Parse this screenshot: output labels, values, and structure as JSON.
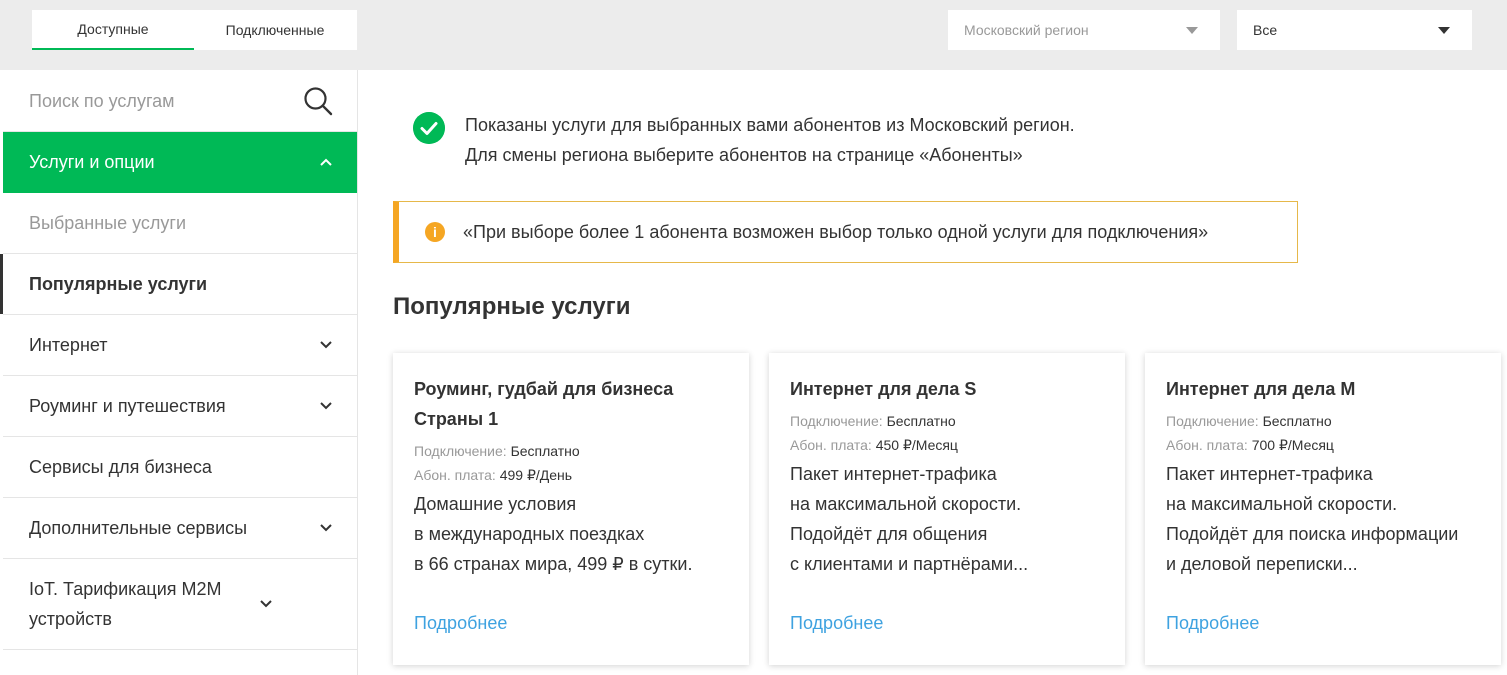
{
  "header": {
    "tabs": [
      {
        "label": "Доступные"
      },
      {
        "label": "Подключенные"
      }
    ],
    "region_select": {
      "value": "Московский регион"
    },
    "filter_select": {
      "value": "Все"
    }
  },
  "sidebar": {
    "search_placeholder": "Поиск по услугам",
    "items": [
      {
        "label": "Услуги и опции"
      },
      {
        "label": "Выбранные услуги"
      },
      {
        "label": "Популярные услуги"
      },
      {
        "label": "Интернет"
      },
      {
        "label": "Роуминг и путешествия"
      },
      {
        "label": "Сервисы для бизнеса"
      },
      {
        "label": "Дополнительные сервисы"
      },
      {
        "label": "IoT. Тарификация M2M устройств"
      }
    ]
  },
  "main": {
    "notice_line1": "Показаны услуги для выбранных вами абонентов из Московский регион.",
    "notice_line2": "Для смены региона выберите абонентов на странице «Абоненты»",
    "warning": "«При выборе более 1 абонента возможен выбор только одной услуги для подключения»",
    "section_title": "Популярные услуги",
    "cards": [
      {
        "title_line1": "Роуминг, гудбай для бизнеса",
        "title_line2": "Страны 1",
        "connection_label": "Подключение:",
        "connection_value": "Бесплатно",
        "fee_label": "Абон. плата:",
        "fee_value": "499 ₽/День",
        "desc_line1": "Домашние условия",
        "desc_line2": "в международных поездках",
        "desc_line3": "в 66 странах мира, 499 ₽ в сутки.",
        "desc_line4": "",
        "more": "Подробнее"
      },
      {
        "title_line1": "Интернет для дела S",
        "title_line2": "",
        "connection_label": "Подключение:",
        "connection_value": "Бесплатно",
        "fee_label": "Абон. плата:",
        "fee_value": "450 ₽/Месяц",
        "desc_line1": "Пакет интернет-трафика",
        "desc_line2": "на максимальной скорости.",
        "desc_line3": "Подойдёт для общения",
        "desc_line4": "с клиентами и партнёрами...",
        "more": "Подробнее"
      },
      {
        "title_line1": "Интернет для дела M",
        "title_line2": "",
        "connection_label": "Подключение:",
        "connection_value": "Бесплатно",
        "fee_label": "Абон. плата:",
        "fee_value": "700 ₽/Месяц",
        "desc_line1": "Пакет интернет-трафика",
        "desc_line2": "на максимальной скорости.",
        "desc_line3": "Подойдёт для поиска информации",
        "desc_line4": "и деловой переписки...",
        "more": "Подробнее"
      }
    ]
  },
  "colors": {
    "accent": "#00b956",
    "warning": "#f5a623",
    "link": "#3ea2e0"
  }
}
